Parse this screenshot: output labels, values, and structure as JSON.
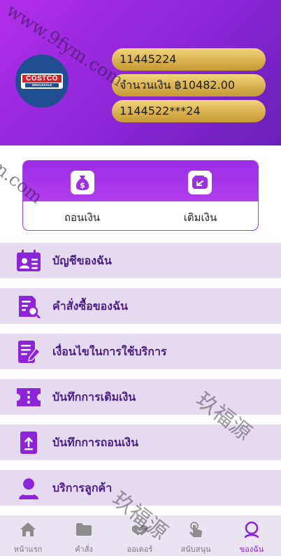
{
  "header": {
    "logo": {
      "brand_text": "COSTCO",
      "sub_text": "WHOLESALE"
    },
    "account_id": "11445224",
    "balance": "จำนวนเงิน ฿10482.00",
    "masked_card": "1144522***24"
  },
  "actions": [
    {
      "label": "ถอนเงิน",
      "icon": "money-bag-icon"
    },
    {
      "label": "เติมเงิน",
      "icon": "wallet-icon"
    }
  ],
  "menu": [
    {
      "label": "บัญชีของฉัน",
      "icon": "id-card-icon"
    },
    {
      "label": "คำสั่งซื้อของฉัน",
      "icon": "order-search-icon"
    },
    {
      "label": "เงื่อนไขในการใช้บริการ",
      "icon": "document-edit-icon"
    },
    {
      "label": "บันทึกการเติมเงิน",
      "icon": "ticket-icon"
    },
    {
      "label": "บันทึกการถอนเงิน",
      "icon": "upload-box-icon"
    },
    {
      "label": "บริการลูกค้า",
      "icon": "customer-service-icon"
    }
  ],
  "nav": [
    {
      "label": "หน้าแรก",
      "icon": "home-icon",
      "active": false
    },
    {
      "label": "คำสั่ง",
      "icon": "folder-icon",
      "active": false
    },
    {
      "label": "ออเดอร์",
      "icon": "handshake-icon",
      "active": false
    },
    {
      "label": "สนับสนุน",
      "icon": "tap-icon",
      "active": false
    },
    {
      "label": "ของฉัน",
      "icon": "profile-icon",
      "active": true
    }
  ],
  "watermarks": [
    "www.9fym.com",
    "m.com",
    "玖福源",
    "玖福源"
  ],
  "colors": {
    "header_purple": "#8a26d6",
    "gold": "#d9b14f",
    "menu_bg": "#e5dbf1",
    "menu_text": "#4a1d88",
    "active_nav": "#8a22d8"
  }
}
